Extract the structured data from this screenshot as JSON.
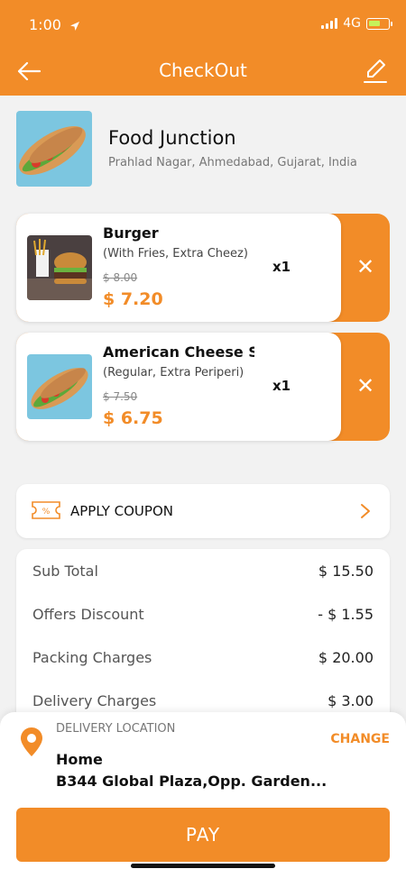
{
  "status_bar": {
    "time": "1:00",
    "network": "4G"
  },
  "header": {
    "title": "CheckOut"
  },
  "restaurant": {
    "name": "Food Junction",
    "address": "Prahlad Nagar, Ahmedabad, Gujarat, India"
  },
  "cart": {
    "items": [
      {
        "name": "Burger",
        "description": "(With Fries, Extra Cheez)",
        "original_price": "$ 8.00",
        "price": "$ 7.20",
        "quantity": "x1",
        "remove": "✕"
      },
      {
        "name": "American Cheese S",
        "description": "(Regular, Extra Periperi)",
        "original_price": "$ 7.50",
        "price": "$ 6.75",
        "quantity": "x1",
        "remove": "✕"
      }
    ]
  },
  "coupon": {
    "label": "APPLY COUPON"
  },
  "bill": {
    "rows": [
      {
        "label": "Sub Total",
        "value": "$ 15.50"
      },
      {
        "label": "Offers Discount",
        "value": "- $ 1.55"
      },
      {
        "label": "Packing Charges",
        "value": "$ 20.00"
      },
      {
        "label": "Delivery Charges",
        "value": "$ 3.00"
      }
    ]
  },
  "delivery": {
    "label": "DELIVERY LOCATION",
    "change_label": "CHANGE",
    "name": "Home",
    "address": "B344 Global Plaza,Opp. Garden..."
  },
  "pay_button": {
    "label": "PAY"
  },
  "colors": {
    "accent": "#f28c28"
  },
  "icons": [
    "location-arrow-icon",
    "signal-icon",
    "battery-icon",
    "back-arrow-icon",
    "edit-icon",
    "close-icon",
    "coupon-icon",
    "chevron-right-icon",
    "location-pin-icon"
  ]
}
